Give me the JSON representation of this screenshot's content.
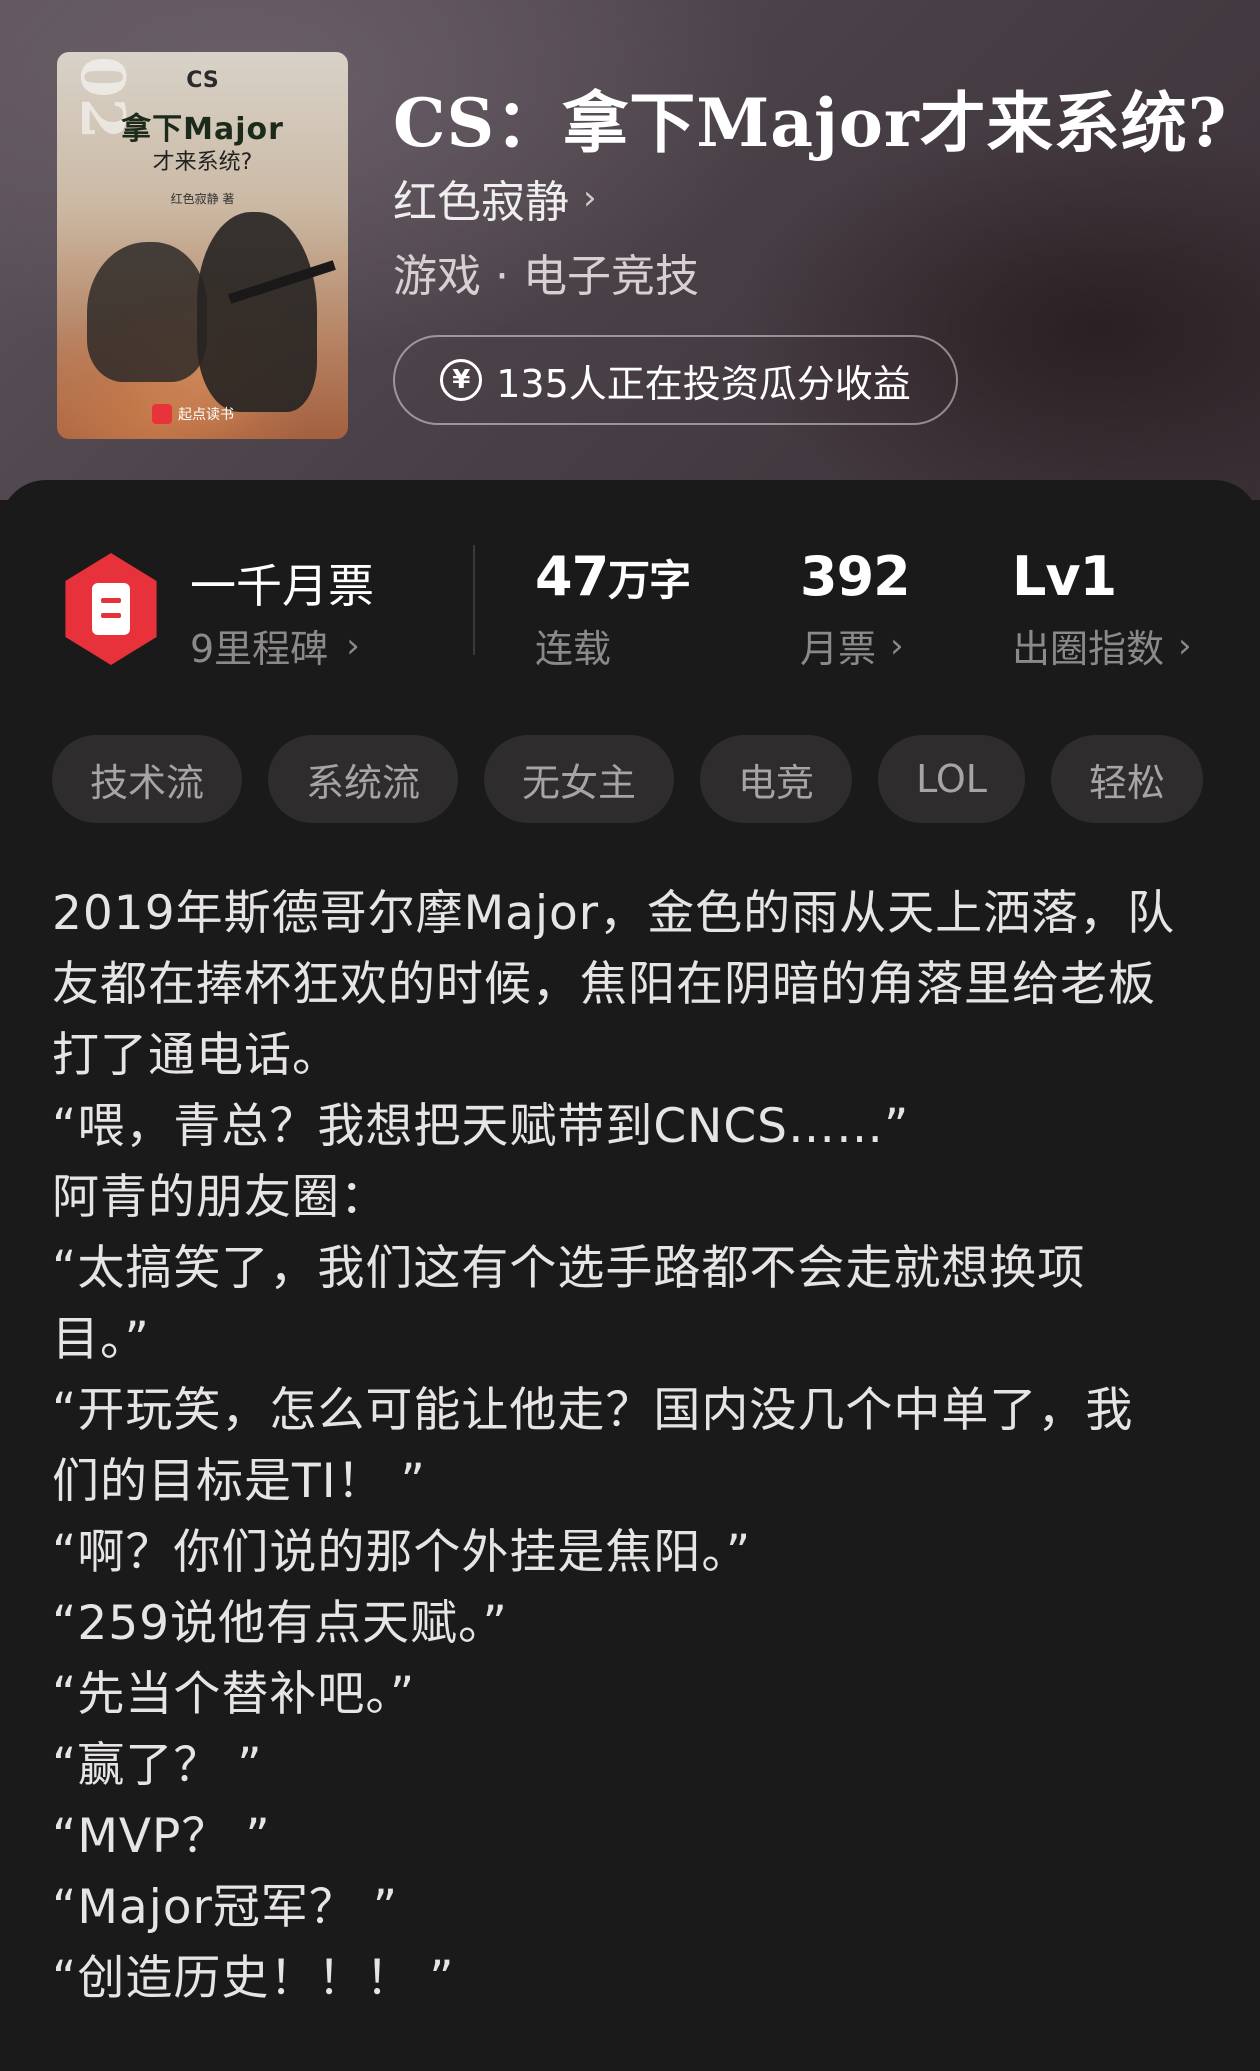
{
  "book": {
    "title": "CS：拿下Major才来系统?",
    "author": "红色寂静",
    "genre": "游戏 · 电子竞技",
    "invest_text": "135人正在投资瓜分收益",
    "cover": {
      "series_number": "02",
      "small_title": "CS",
      "title_line1": "拿下Major",
      "title_line2": "才来系统?",
      "author": "红色寂静 著",
      "brand": "起点读书"
    }
  },
  "stats": {
    "rank_title": "一千月票",
    "rank_sub": "9里程碑",
    "words_value": "47",
    "words_unit": "万字",
    "words_label": "连载",
    "votes_value": "392",
    "votes_label": "月票",
    "level_value": "Lv1",
    "level_label": "出圈指数"
  },
  "tags": [
    "技术流",
    "系统流",
    "无女主",
    "电竞",
    "LOL",
    "轻松"
  ],
  "description": [
    "2019年斯德哥尔摩Major，金色的雨从天上洒落，队",
    "友都在捧杯狂欢的时候，焦阳在阴暗的角落里给老板",
    "打了通电话。",
    "“喂，青总？我想把天赋带到CNCS……”",
    "阿青的朋友圈：",
    "“太搞笑了，我们这有个选手路都不会走就想换项",
    "目。”",
    "“开玩笑，怎么可能让他走？国内没几个中单了，我",
    "们的目标是TI！ ”",
    "“啊？你们说的那个外挂是焦阳。”",
    "“259说他有点天赋。”",
    "“先当个替补吧。”",
    "“赢了？ ”",
    "“MVP？ ”",
    "“Major冠军？ ”",
    "“创造历史！！！ ”"
  ],
  "colors": {
    "accent_red": "#e8323b",
    "panel_bg": "#1b1a1b",
    "tag_bg": "#2e2c2d"
  }
}
